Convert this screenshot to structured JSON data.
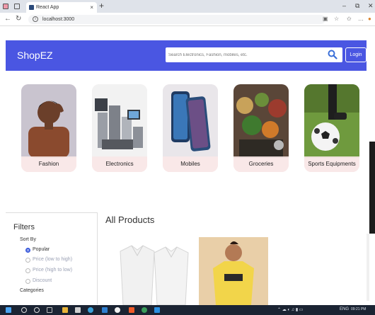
{
  "browser": {
    "tab_title": "React App",
    "tab_close": "×",
    "new_tab": "+",
    "url": "localhost:3000",
    "window_min": "–",
    "window_max": "⧉",
    "window_close": "✕"
  },
  "header": {
    "brand": "ShopEZ",
    "search_placeholder": "Search Electronics, Fashion, mobiles, etc.",
    "login_label": "Login",
    "bg_color": "#4a56e2"
  },
  "categories": [
    {
      "label": "Fashion"
    },
    {
      "label": "Electronics"
    },
    {
      "label": "Mobiles"
    },
    {
      "label": "Groceries"
    },
    {
      "label": "Sports Equipments"
    }
  ],
  "filters": {
    "title": "Filters",
    "sort_by_label": "Sort By",
    "options": [
      {
        "label": "Popular",
        "checked": true
      },
      {
        "label": "Price (low to high)",
        "checked": false
      },
      {
        "label": "Price (high to low)",
        "checked": false
      },
      {
        "label": "Discount",
        "checked": false
      }
    ],
    "categories_label": "Categories"
  },
  "products": {
    "title": "All Products"
  },
  "taskbar": {
    "tray_text": "ENG",
    "clock_time": "09:21 PM"
  }
}
